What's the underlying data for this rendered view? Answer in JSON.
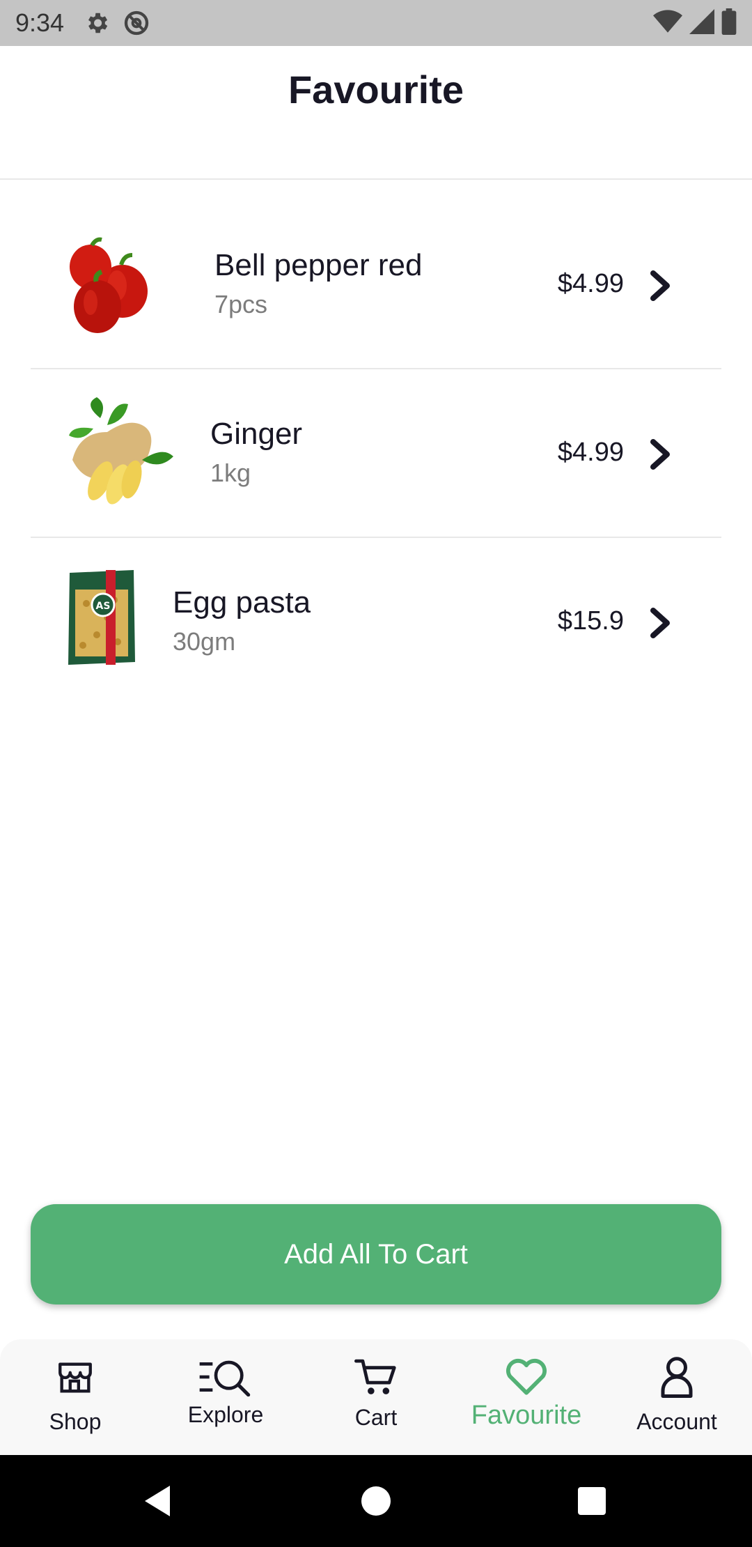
{
  "status_bar": {
    "time": "9:34",
    "icons": [
      "gear-icon",
      "at-sign-icon",
      "wifi-icon",
      "signal-icon",
      "battery-icon"
    ]
  },
  "header": {
    "title": "Favourite"
  },
  "favourites": [
    {
      "name": "Bell pepper red",
      "quantity": "7pcs",
      "price": "$4.99",
      "image": "bell-pepper-image"
    },
    {
      "name": "Ginger",
      "quantity": "1kg",
      "price": "$4.99",
      "image": "ginger-image"
    },
    {
      "name": "Egg pasta",
      "quantity": "30gm",
      "price": "$15.9",
      "image": "egg-pasta-image"
    }
  ],
  "actions": {
    "add_all_label": "Add All To Cart"
  },
  "bottom_nav": {
    "items": [
      {
        "label": "Shop",
        "icon": "store-icon",
        "active": false
      },
      {
        "label": "Explore",
        "icon": "explore-icon",
        "active": false
      },
      {
        "label": "Cart",
        "icon": "cart-icon",
        "active": false
      },
      {
        "label": "Favourite",
        "icon": "heart-icon",
        "active": true
      },
      {
        "label": "Account",
        "icon": "user-icon",
        "active": false
      }
    ]
  },
  "colors": {
    "accent": "#53B175",
    "text_primary": "#181725",
    "text_secondary": "#7C7C7C",
    "status_bar": "#C4C4C4"
  }
}
